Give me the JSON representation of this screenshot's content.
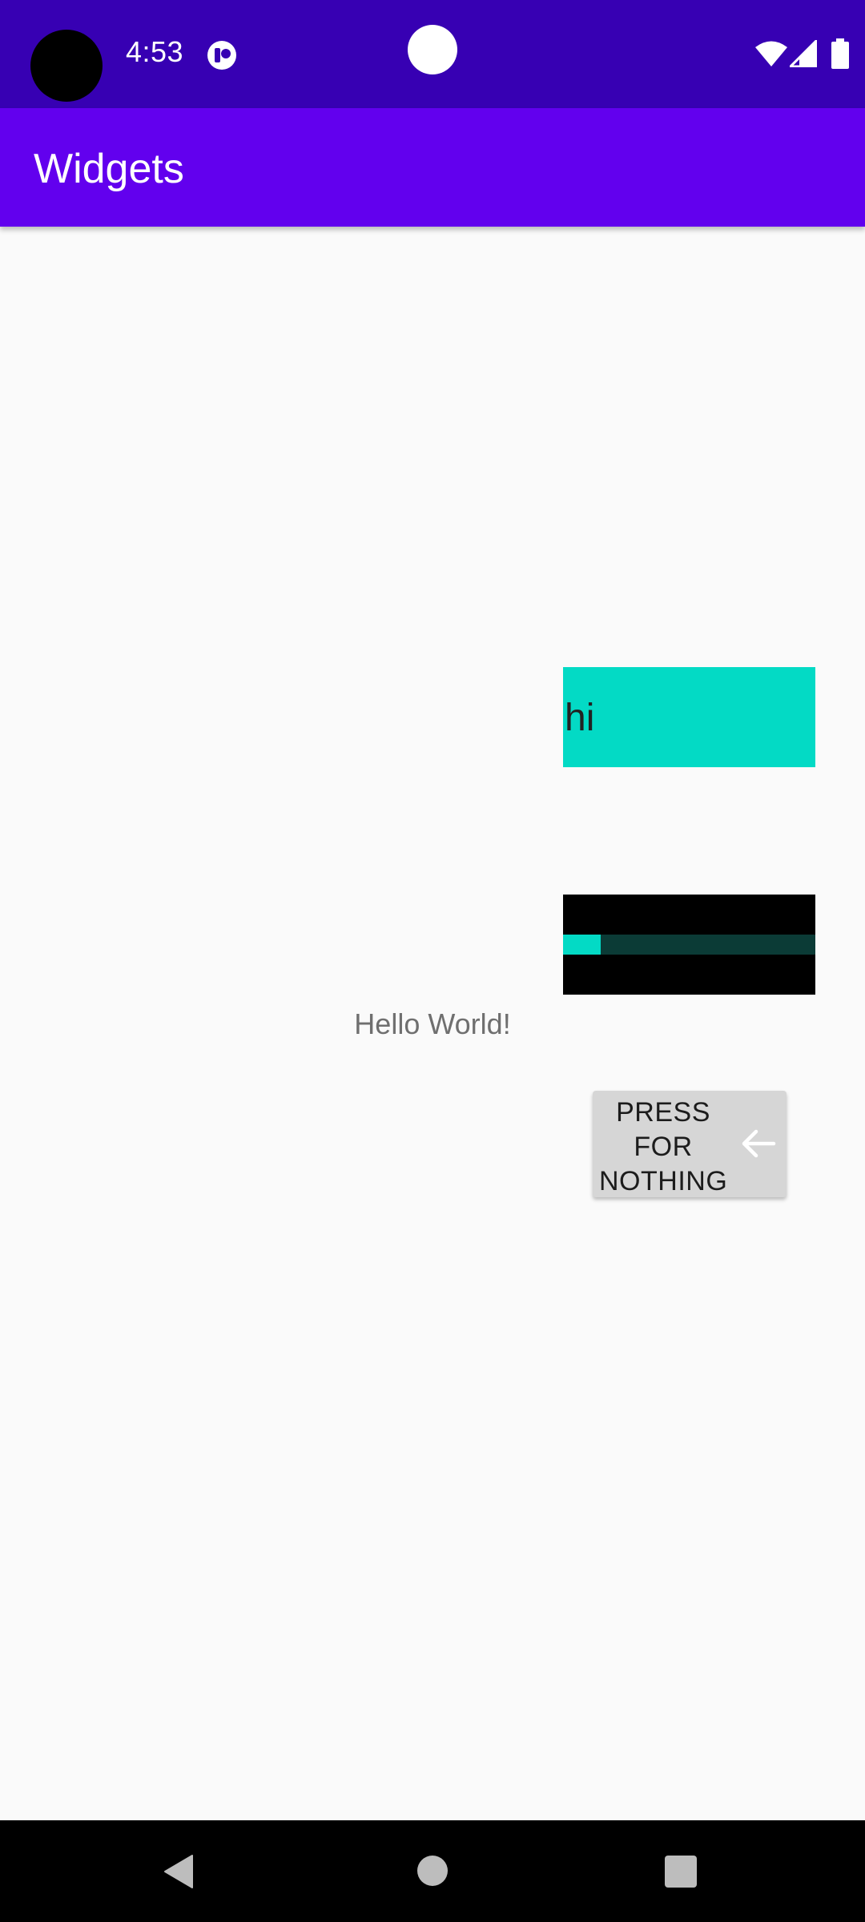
{
  "status_bar": {
    "time": "4:53",
    "bg_color": "#3700b3",
    "icons": [
      "camera-cutout-icon",
      "notification-app-icon",
      "wifi-icon",
      "cell-signal-icon",
      "battery-icon"
    ]
  },
  "app_bar": {
    "title": "Widgets",
    "bg_color": "#6200ee"
  },
  "content": {
    "text_box": {
      "text": "hi",
      "bg_color": "#03dac5"
    },
    "progress": {
      "value_fraction": 0.15,
      "fill_color": "#03dac5"
    },
    "hello_text": "Hello World!",
    "button": {
      "label": "PRESS FOR NOTHING",
      "icon": "arrow-left-icon"
    }
  },
  "nav_bar": {
    "icons": [
      "back-icon",
      "home-icon",
      "recents-icon"
    ]
  }
}
